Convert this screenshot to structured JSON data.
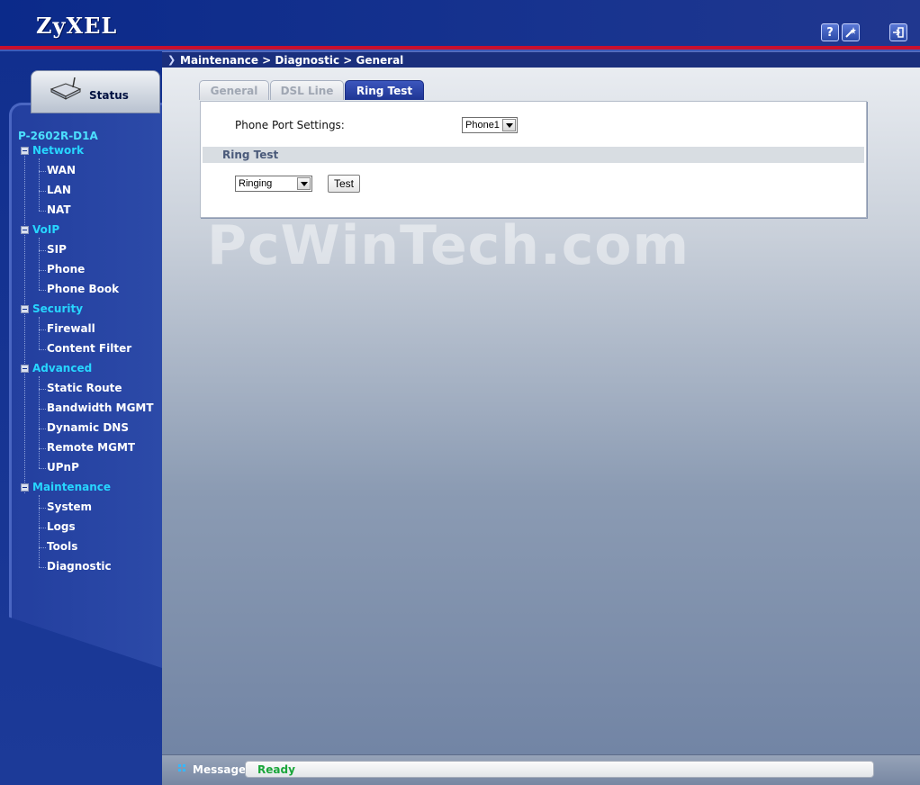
{
  "header": {
    "brand": "ZyXEL",
    "help_icon": "question-mark-icon",
    "wizard_icon": "wizard-wand-icon",
    "logout_icon": "logout-icon"
  },
  "sidebar": {
    "status_tab": "Status",
    "device": "P-2602R-D1A",
    "sections": [
      {
        "label": "Network",
        "items": [
          "WAN",
          "LAN",
          "NAT"
        ]
      },
      {
        "label": "VoIP",
        "items": [
          "SIP",
          "Phone",
          "Phone Book"
        ]
      },
      {
        "label": "Security",
        "items": [
          "Firewall",
          "Content Filter"
        ]
      },
      {
        "label": "Advanced",
        "items": [
          "Static Route",
          "Bandwidth MGMT",
          "Dynamic DNS",
          "Remote MGMT",
          "UPnP"
        ]
      },
      {
        "label": "Maintenance",
        "items": [
          "System",
          "Logs",
          "Tools",
          "Diagnostic"
        ]
      }
    ]
  },
  "breadcrumb": "Maintenance > Diagnostic > General",
  "tabs": [
    {
      "label": "General",
      "active": false
    },
    {
      "label": "DSL Line",
      "active": false
    },
    {
      "label": "Ring Test",
      "active": true
    }
  ],
  "form": {
    "phone_port_label": "Phone Port Settings:",
    "phone_port_value": "Phone1",
    "section_title": "Ring Test",
    "ring_mode_value": "Ringing",
    "test_button": "Test"
  },
  "watermark": "PcWinTech.com",
  "message_bar": {
    "label": "Message",
    "status": "Ready"
  },
  "colors": {
    "accent_cyan": "#27d6ff",
    "active_tab": "#1e3593",
    "ready_green": "#1aa63a"
  }
}
